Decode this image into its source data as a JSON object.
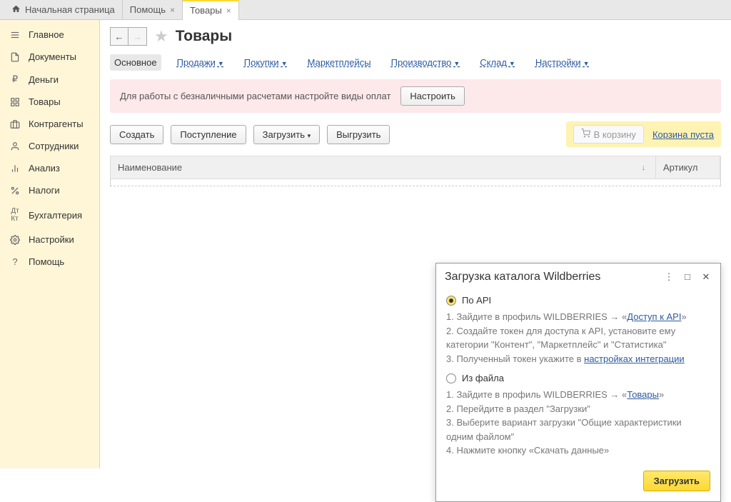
{
  "tabs": {
    "home": "Начальная страница",
    "help": "Помощь",
    "products": "Товары"
  },
  "sidebar": {
    "items": [
      {
        "label": "Главное"
      },
      {
        "label": "Документы"
      },
      {
        "label": "Деньги"
      },
      {
        "label": "Товары"
      },
      {
        "label": "Контрагенты"
      },
      {
        "label": "Сотрудники"
      },
      {
        "label": "Анализ"
      },
      {
        "label": "Налоги"
      },
      {
        "label": "Бухгалтерия"
      },
      {
        "label": "Настройки"
      },
      {
        "label": "Помощь"
      }
    ]
  },
  "page": {
    "title": "Товары"
  },
  "subtabs": {
    "main": "Основное",
    "sales": "Продажи",
    "purchases": "Покупки",
    "marketplaces": "Маркетплейсы",
    "production": "Производство",
    "warehouse": "Склад",
    "settings": "Настройки"
  },
  "warning": {
    "text": "Для работы с безналичными расчетами настройте виды оплат",
    "button": "Настроить"
  },
  "toolbar": {
    "create": "Создать",
    "receipt": "Поступление",
    "load": "Загрузить",
    "unload": "Выгрузить",
    "to_cart": "В корзину",
    "cart_empty": "Корзина пуста"
  },
  "table": {
    "name_col": "Наименование",
    "article_col": "Артикул"
  },
  "dialog": {
    "title": "Загрузка каталога Wildberries",
    "option_api": "По API",
    "option_file": "Из файла",
    "api_step1_prefix": "1. Зайдите в профиль WILDBERRIES → «",
    "api_step1_link": "Доступ к API",
    "api_step1_suffix": "»",
    "api_step2": "2. Создайте токен для доступа к API, установите ему категории \"Контент\", \"Маркетплейс\" и \"Статистика\"",
    "api_step3_prefix": "3. Полученный токен укажите в ",
    "api_step3_link": "настройках интеграции",
    "file_step1_prefix": "1. Зайдите в профиль WILDBERRIES → «",
    "file_step1_link": "Товары",
    "file_step1_suffix": "»",
    "file_step2": "2. Перейдите в раздел \"Загрузки\"",
    "file_step3": "3. Выберите вариант загрузки \"Общие характеристики одним файлом\"",
    "file_step4": "4. Нажмите кнопку «Скачать данные»",
    "load_button": "Загрузить"
  }
}
